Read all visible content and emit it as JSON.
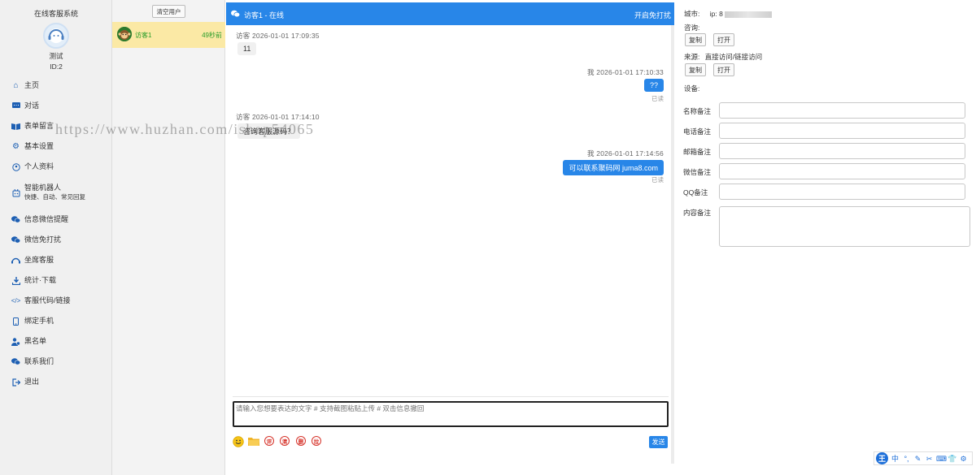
{
  "sidebar": {
    "title": "在线客服系统",
    "user_name": "测试",
    "user_id": "ID:2",
    "items": [
      {
        "label": "主页",
        "icon": "home-icon"
      },
      {
        "label": "对话",
        "icon": "chat-icon"
      },
      {
        "label": "表单留言",
        "icon": "book-icon"
      },
      {
        "label": "基本设置",
        "icon": "gear-icon"
      },
      {
        "label": "个人资料",
        "icon": "profile-icon"
      },
      {
        "label": "智能机器人",
        "sub": "快捷、自动、常见回复",
        "icon": "robot-icon"
      },
      {
        "label": "信息微信提醒",
        "icon": "wechat-icon"
      },
      {
        "label": "微信免打扰",
        "icon": "wechat-mute-icon"
      },
      {
        "label": "坐席客服",
        "icon": "headset-icon"
      },
      {
        "label": "统计·下载",
        "icon": "download-icon"
      },
      {
        "label": "客服代码/链接",
        "icon": "code-icon"
      },
      {
        "label": "绑定手机",
        "icon": "phone-icon"
      },
      {
        "label": "黑名单",
        "icon": "blacklist-icon"
      },
      {
        "label": "联系我们",
        "icon": "contact-icon"
      },
      {
        "label": "退出",
        "icon": "logout-icon"
      }
    ]
  },
  "visitors": {
    "clear_label": "清空用户",
    "list": [
      {
        "name": "访客1",
        "time": "49秒前"
      }
    ]
  },
  "chat": {
    "title": "访客1 - 在线",
    "dnd_label": "开启免打扰",
    "messages": [
      {
        "side": "left",
        "meta": "访客  2026-01-01 17:09:35",
        "text": "11"
      },
      {
        "side": "right",
        "meta": "我  2026-01-01 17:10:33",
        "text": "??",
        "status": "已读"
      },
      {
        "side": "left",
        "meta": "访客  2026-01-01 17:14:10",
        "text": "咨询客服源码？"
      },
      {
        "side": "right",
        "meta": "我  2026-01-01 17:14:56",
        "text": "可以联系聚码网 juma8.com",
        "status": "已读"
      }
    ],
    "input_placeholder": "请输入您想要表达的文字 # 支持截图粘贴上传 # 双击信息撤回",
    "tools": [
      {
        "name": "emoji-icon",
        "label": ""
      },
      {
        "name": "folder-icon",
        "label": ""
      },
      {
        "name": "evaluate-icon",
        "label": "评"
      },
      {
        "name": "clear-icon",
        "label": "清"
      },
      {
        "name": "delete-icon",
        "label": "删"
      },
      {
        "name": "block-icon",
        "label": "拉"
      }
    ],
    "send_label": "发送",
    "colors": {
      "accent": "#2886e8",
      "tool_red": "#d6332a"
    }
  },
  "watermark": "https://www.huzhan.com/ishop54065",
  "info": {
    "city_label": "城市:",
    "ip_label": "ip: 8",
    "consult_label": "咨询:",
    "copy_label": "复制",
    "open_label": "打开",
    "source_label": "来源:",
    "source_value": "直接访问/链接访问",
    "device_label": "设备:",
    "fields": [
      {
        "label": "名称备注"
      },
      {
        "label": "电话备注"
      },
      {
        "label": "邮箱备注"
      },
      {
        "label": "微信备注"
      },
      {
        "label": "QQ备注"
      },
      {
        "label": "内容备注"
      }
    ]
  },
  "ime": {
    "logo": "王",
    "items": [
      "中",
      "°,",
      "✎",
      "✂",
      "⌨",
      "👕",
      "⚙"
    ]
  }
}
